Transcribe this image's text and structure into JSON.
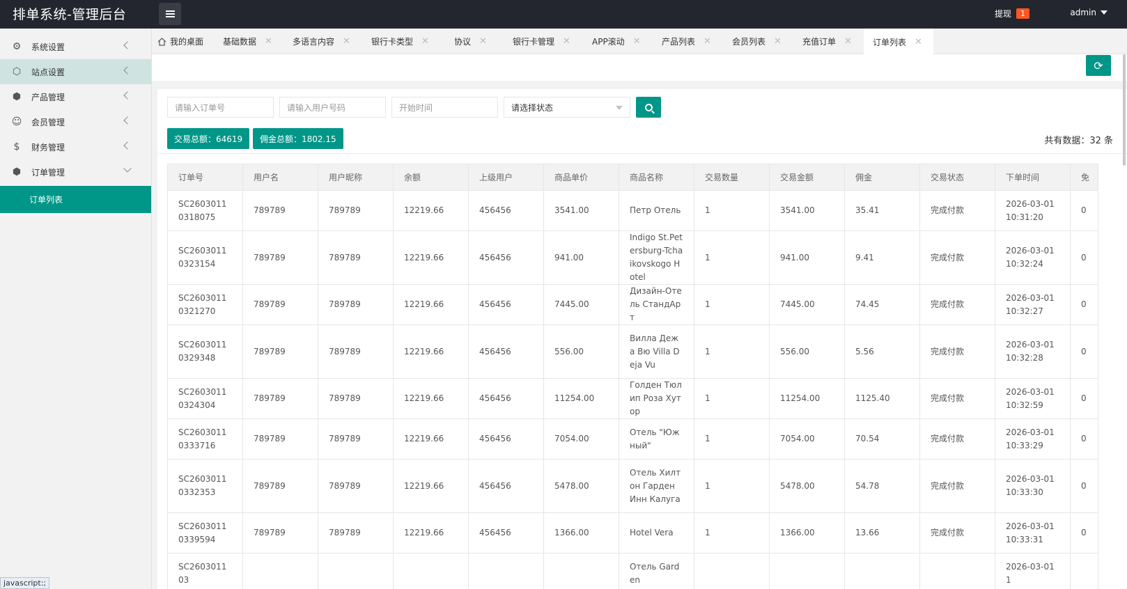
{
  "header": {
    "title": "排单系统-管理后台",
    "withdraw_label": "提现",
    "withdraw_badge": "1",
    "user": "admin"
  },
  "sidebar": {
    "items": [
      {
        "label": "系统设置",
        "icon": "gear-icon"
      },
      {
        "label": "站点设置",
        "icon": "site-icon"
      },
      {
        "label": "产品管理",
        "icon": "box-icon"
      },
      {
        "label": "会员管理",
        "icon": "user-icon"
      },
      {
        "label": "财务管理",
        "icon": "dollar-icon"
      },
      {
        "label": "订单管理",
        "icon": "box-icon"
      }
    ],
    "sub_item": "订单列表"
  },
  "tabs": [
    "我的桌面",
    "基础数据",
    "多语言内容",
    "银行卡类型",
    "协议",
    "银行卡管理",
    "APP滚动",
    "产品列表",
    "会员列表",
    "充值订单",
    "订单列表"
  ],
  "filters": {
    "order_no_placeholder": "请输入订单号",
    "user_no_placeholder": "请输入用户号码",
    "start_time_placeholder": "开始时间",
    "status_select": "请选择状态"
  },
  "summary": {
    "trade_total": "交易总额：64619",
    "commission_total": "佣金总额：1802.15",
    "count_text": "共有数据：32 条"
  },
  "table": {
    "headers": [
      "订单号",
      "用户名",
      "用户昵称",
      "余额",
      "上级用户",
      "商品单价",
      "商品名称",
      "交易数量",
      "交易金额",
      "佣金",
      "交易状态",
      "下单时间",
      "免"
    ],
    "rows": [
      [
        "SC26030110318075",
        "789789",
        "789789",
        "12219.66",
        "456456",
        "3541.00",
        "Петр Отель",
        "1",
        "3541.00",
        "35.41",
        "完成付款",
        "2026-03-01 10:31:20",
        "0"
      ],
      [
        "SC26030110323154",
        "789789",
        "789789",
        "12219.66",
        "456456",
        "941.00",
        "Indigo St.Petersburg-Tchaikovskogo Hotel",
        "1",
        "941.00",
        "9.41",
        "完成付款",
        "2026-03-01 10:32:24",
        "0"
      ],
      [
        "SC26030110321270",
        "789789",
        "789789",
        "12219.66",
        "456456",
        "7445.00",
        "Дизайн-Отель СтандАрт",
        "1",
        "7445.00",
        "74.45",
        "完成付款",
        "2026-03-01 10:32:27",
        "0"
      ],
      [
        "SC26030110329348",
        "789789",
        "789789",
        "12219.66",
        "456456",
        "556.00",
        "Вилла Дежа Вю Villa Deja Vu",
        "1",
        "556.00",
        "5.56",
        "完成付款",
        "2026-03-01 10:32:28",
        "0"
      ],
      [
        "SC26030110324304",
        "789789",
        "789789",
        "12219.66",
        "456456",
        "11254.00",
        "Голден Тюлип Роза Хутор",
        "1",
        "11254.00",
        "1125.40",
        "完成付款",
        "2026-03-01 10:32:59",
        "0"
      ],
      [
        "SC26030110333716",
        "789789",
        "789789",
        "12219.66",
        "456456",
        "7054.00",
        "Отель \"Южный\"",
        "1",
        "7054.00",
        "70.54",
        "完成付款",
        "2026-03-01 10:33:29",
        "0"
      ],
      [
        "SC26030110332353",
        "789789",
        "789789",
        "12219.66",
        "456456",
        "5478.00",
        "Отель Хилтон Гарден Инн Калуга",
        "1",
        "5478.00",
        "54.78",
        "完成付款",
        "2026-03-01 10:33:30",
        "0"
      ],
      [
        "SC26030110339594",
        "789789",
        "789789",
        "12219.66",
        "456456",
        "1366.00",
        "Hotel Vera",
        "1",
        "1366.00",
        "13.66",
        "完成付款",
        "2026-03-01 10:33:31",
        "0"
      ],
      [
        "SC260301103",
        "",
        "",
        "",
        "",
        "",
        "Отель Garden",
        "",
        "",
        "",
        "",
        "2026-03-01 1",
        ""
      ]
    ]
  },
  "statusbar": "javascript:;",
  "colors": {
    "accent": "#009688",
    "header_bg": "#23262e",
    "badge": "#ff5722"
  }
}
